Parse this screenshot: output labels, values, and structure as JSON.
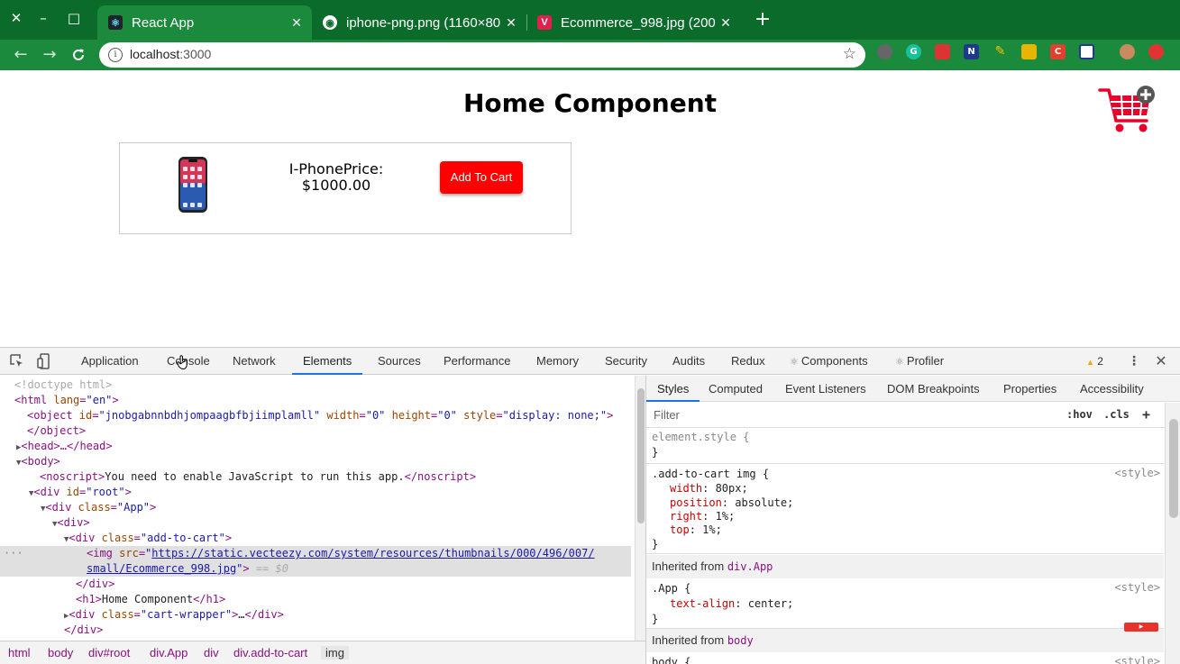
{
  "window": {
    "close": "✕",
    "minimize": "–",
    "maximize": "□"
  },
  "tabs": [
    {
      "title": "React App",
      "close": "✕"
    },
    {
      "title": "iphone-png.png (1160×80",
      "close": "✕"
    },
    {
      "title": "Ecommerce_998.jpg (200",
      "close": "✕"
    }
  ],
  "new_tab": "+",
  "toolbar": {
    "back": "←",
    "forward": "→",
    "reload": "C",
    "url_host": "localhost",
    "url_port": ":3000",
    "info": "i",
    "star": "☆"
  },
  "page": {
    "title": "Home Component",
    "product_name": "I-PhonePrice:",
    "product_price": "$1000.00",
    "add_to_cart_label": "Add To Cart"
  },
  "devtools": {
    "tabs": [
      "Application",
      "Console",
      "Network",
      "Elements",
      "Sources",
      "Performance",
      "Memory",
      "Security",
      "Audits",
      "Redux",
      "Components",
      "Profiler"
    ],
    "active_tab": "Elements",
    "warning_count": "2",
    "dom": {
      "doctype": "<!doctype html>",
      "html_open": "<html ",
      "html_lang_attr": "lang",
      "html_lang_val": "\"en\"",
      "object_line": "<object ",
      "object_id_attr": "id",
      "object_id_val": "\"jnobgabnnbdhjompaagbfbjiimplamll\"",
      "object_width_attr": "width",
      "object_width_val": "\"0\"",
      "object_height_attr": "height",
      "object_height_val": "\"0\"",
      "object_style_attr": "style",
      "object_style_val": "\"display: none;\"",
      "object_close": "</object>",
      "head": "<head>…</head>",
      "body_open": "<body>",
      "noscript_open": "<noscript>",
      "noscript_text": "You need to enable JavaScript to run this app.",
      "noscript_close": "</noscript>",
      "root_tag": "<div ",
      "root_attr": "id",
      "root_val": "\"root\"",
      "app_attr": "class",
      "app_val": "\"App\"",
      "div_open": "<div>",
      "addcart_val": "\"add-to-cart\"",
      "img_tag": "<img ",
      "img_src_attr": "src",
      "img_src_line1": "https://static.vecteezy.com/system/resources/thumbnails/000/496/007/",
      "img_src_line2": "small/Ecommerce_998.jpg",
      "img_eq": "== $0",
      "div_close": "</div>",
      "h1_open": "<h1>",
      "h1_text": "Home Component",
      "h1_close": "</h1>",
      "cartwrap_val": "\"cart-wrapper\"",
      "ellipsis": "…",
      "dots": "···"
    },
    "breadcrumbs": [
      "html",
      "body",
      "div#root",
      "div.App",
      "div",
      "div.add-to-cart",
      "img"
    ],
    "styles_tabs": [
      "Styles",
      "Computed",
      "Event Listeners",
      "DOM Breakpoints",
      "Properties",
      "Accessibility"
    ],
    "filter_placeholder": "Filter",
    "hov": ":hov",
    "cls": ".cls",
    "plus": "+",
    "element_style": "element.style {",
    "close_brace": "}",
    "rule1": {
      "selector": ".add-to-cart img {",
      "source": "<style>",
      "props": [
        {
          "name": "width",
          "value": "80px;"
        },
        {
          "name": "position",
          "value": "absolute;"
        },
        {
          "name": "right",
          "value": "1%;"
        },
        {
          "name": "top",
          "value": "1%;"
        }
      ]
    },
    "inherited1": {
      "label": "Inherited from ",
      "selector": "div.App"
    },
    "rule2": {
      "selector": ".App {",
      "source": "<style>",
      "props": [
        {
          "name": "text-align",
          "value": "center;"
        }
      ]
    },
    "inherited2": {
      "label": "Inherited from ",
      "selector": "body"
    },
    "rule3": {
      "selector": "body {",
      "source": "<style>"
    }
  },
  "colors": {
    "tab_strip": "#0b6b2a",
    "toolbar": "#1b8a3d",
    "button": "#ff0000"
  },
  "icons": {
    "cart": "cart-icon",
    "phone": "iphone-image",
    "inspect": "inspect-element-icon",
    "device": "device-toolbar-icon",
    "menu": "kebab-menu-icon",
    "close": "close-icon"
  }
}
